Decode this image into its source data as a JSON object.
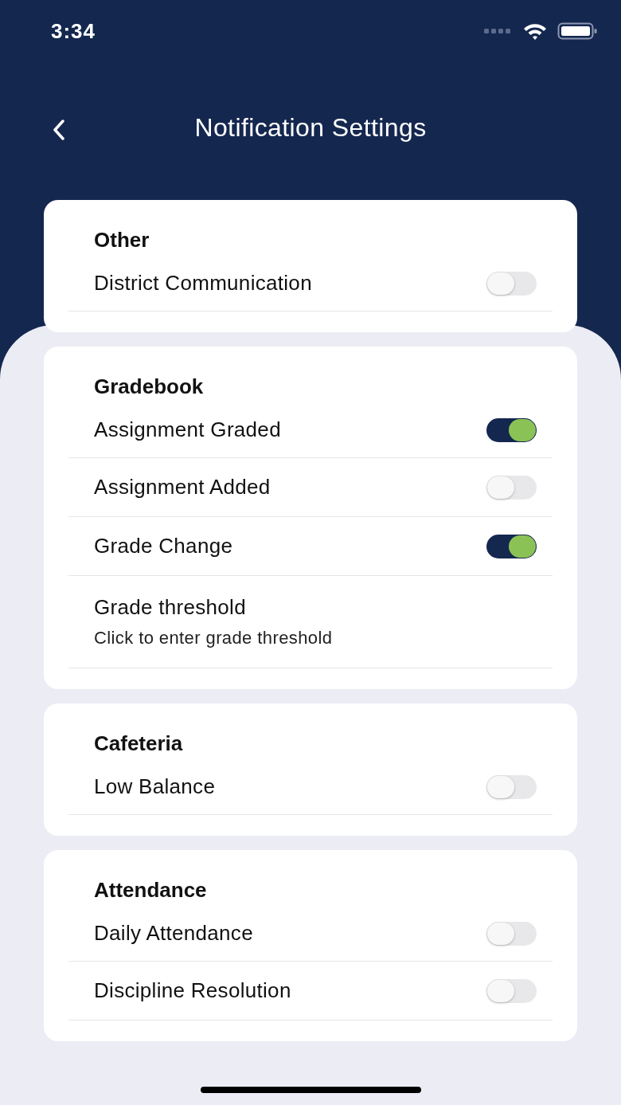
{
  "status_bar": {
    "time": "3:34"
  },
  "header": {
    "title": "Notification Settings"
  },
  "sections": [
    {
      "title": "Other",
      "rows": [
        {
          "kind": "toggle",
          "label": "District Communication",
          "on": false
        }
      ]
    },
    {
      "title": "Gradebook",
      "rows": [
        {
          "kind": "toggle",
          "label": "Assignment Graded",
          "on": true
        },
        {
          "kind": "toggle",
          "label": "Assignment Added",
          "on": false
        },
        {
          "kind": "toggle",
          "label": "Grade Change",
          "on": true
        },
        {
          "kind": "link",
          "label": "Grade threshold",
          "subtitle": "Click to enter grade threshold"
        }
      ]
    },
    {
      "title": "Cafeteria",
      "rows": [
        {
          "kind": "toggle",
          "label": "Low Balance",
          "on": false
        }
      ]
    },
    {
      "title": "Attendance",
      "rows": [
        {
          "kind": "toggle",
          "label": "Daily Attendance",
          "on": false
        },
        {
          "kind": "toggle",
          "label": "Discipline Resolution",
          "on": false
        }
      ]
    }
  ]
}
